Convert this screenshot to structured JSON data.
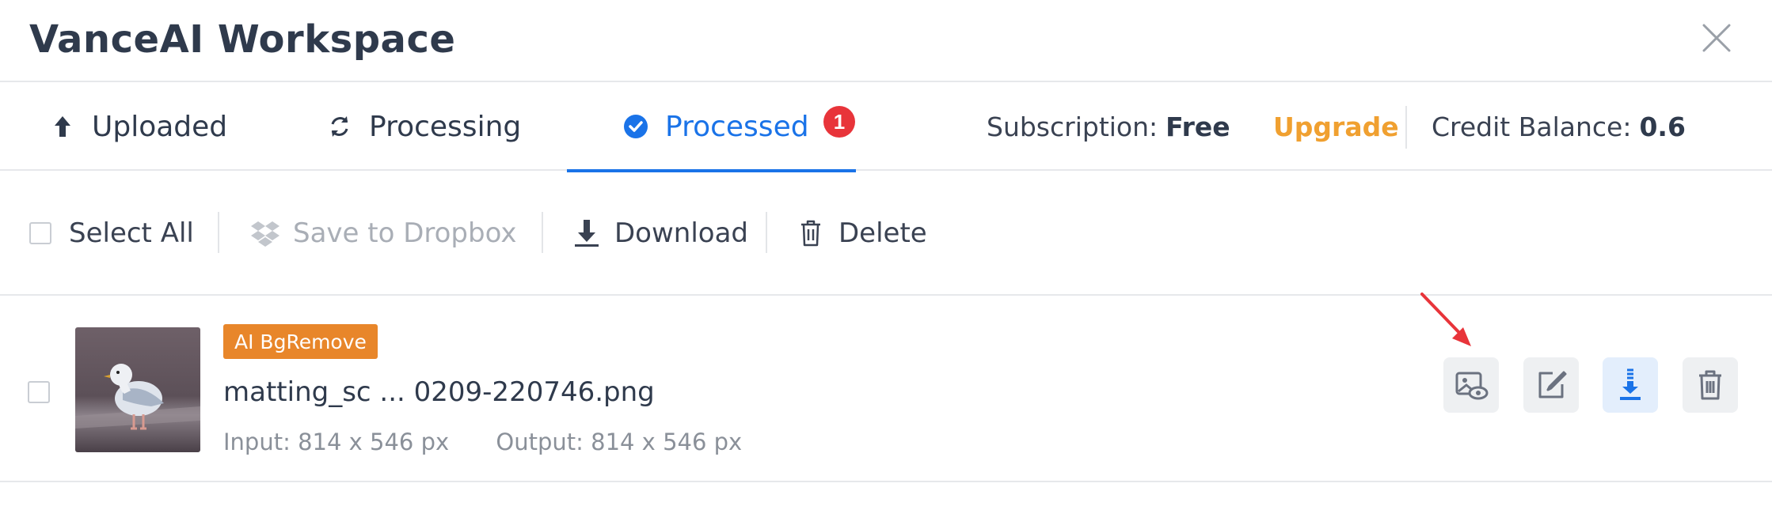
{
  "window": {
    "title": "VanceAI Workspace"
  },
  "tabs": [
    {
      "label": "Uploaded",
      "icon": "upload-arrow-icon"
    },
    {
      "label": "Processing",
      "icon": "refresh-icon"
    },
    {
      "label": "Processed",
      "icon": "check-circle-icon",
      "badge": "1",
      "active": true
    }
  ],
  "subscription": {
    "label": "Subscription:",
    "value": "Free"
  },
  "upgrade_label": "Upgrade",
  "credit": {
    "label": "Credit Balance:",
    "value": "0.6"
  },
  "toolbar": {
    "select_all": "Select All",
    "dropbox": "Save to Dropbox",
    "download": "Download",
    "delete": "Delete"
  },
  "files": [
    {
      "tag": "AI BgRemove",
      "name": "matting_sc ... 0209-220746.png",
      "input": "Input: 814 x 546 px",
      "output": "Output: 814 x 546 px",
      "selected": false
    }
  ],
  "colors": {
    "accent": "#1a73e8",
    "badge": "#e8343a",
    "upgrade": "#f0a030",
    "tag": "#e8862a",
    "annotation_arrow": "#e8343a"
  }
}
